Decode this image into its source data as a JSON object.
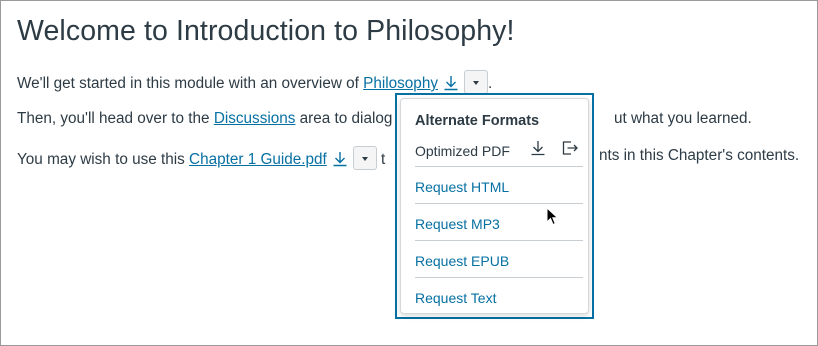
{
  "page": {
    "title": "Welcome to Introduction to Philosophy!",
    "para1": {
      "prefix": "We'll get started in this module with an overview of ",
      "link": "Philosophy",
      "suffix": "."
    },
    "para2": {
      "prefix": "Then, you'll head over to the ",
      "link": "Discussions",
      "suffix_visible_left": " area to dialog",
      "suffix_visible_right": "ut what you learned."
    },
    "para3": {
      "prefix": "You may wish to use this ",
      "link": "Chapter 1 Guide.pdf",
      "suffix_visible_left": " t",
      "suffix_visible_right": "nts in this Chapter's contents."
    }
  },
  "popup": {
    "title": "Alternate Formats",
    "optimized_label": "Optimized PDF",
    "items": [
      {
        "label": "Request HTML"
      },
      {
        "label": "Request MP3"
      },
      {
        "label": "Request EPUB"
      },
      {
        "label": "Request Text"
      }
    ]
  },
  "icons": {
    "download": "download-icon",
    "menu": "chevron-down-icon",
    "open": "open-external-icon",
    "cursor": "mouse-pointer-icon"
  },
  "colors": {
    "link": "#0770a3",
    "text": "#2d3b45",
    "popup_border": "#0770a3"
  }
}
